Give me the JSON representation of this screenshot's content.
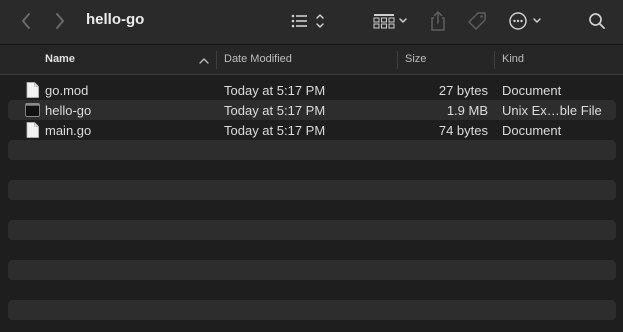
{
  "window": {
    "title": "hello-go"
  },
  "toolbar": {
    "back_icon": "chevron-left-icon",
    "forward_icon": "chevron-right-icon",
    "view_icon": "list-view-icon",
    "group_icon": "group-grid-icon",
    "share_icon": "share-icon",
    "tag_icon": "tag-icon",
    "more_icon": "ellipsis-circle-icon",
    "search_icon": "search-icon"
  },
  "columns": {
    "name": "Name",
    "date": "Date Modified",
    "size": "Size",
    "kind": "Kind"
  },
  "files": [
    {
      "name": "go.mod",
      "icon": "document-icon",
      "date": "Today at 5:17 PM",
      "size": "27 bytes",
      "kind": "Document"
    },
    {
      "name": "hello-go",
      "icon": "executable-icon",
      "date": "Today at 5:17 PM",
      "size": "1.9 MB",
      "kind": "Unix Ex…ble File"
    },
    {
      "name": "main.go",
      "icon": "document-icon",
      "date": "Today at 5:17 PM",
      "size": "74 bytes",
      "kind": "Document"
    }
  ]
}
